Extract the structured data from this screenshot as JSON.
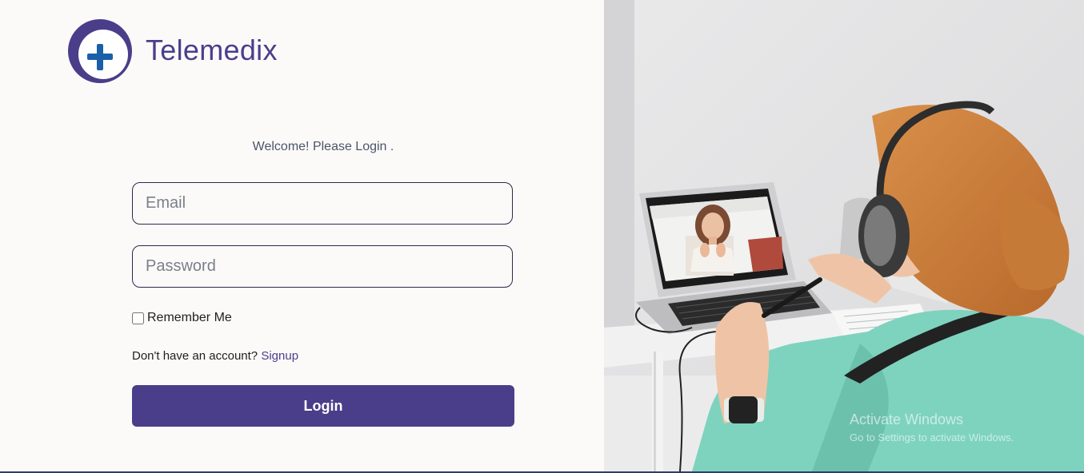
{
  "brand": {
    "name": "Telemedix"
  },
  "login": {
    "welcome": "Welcome! Please Login .",
    "email_placeholder": "Email",
    "password_placeholder": "Password",
    "remember_label": "Remember Me",
    "signup_prompt": "Don't have an account?",
    "signup_link": "Signup",
    "login_button": "Login"
  },
  "watermark": {
    "title": "Activate Windows",
    "subtitle": "Go to Settings to activate Windows."
  },
  "colors": {
    "primary": "#4a3d8a",
    "accent_blue": "#1a5fa8"
  }
}
